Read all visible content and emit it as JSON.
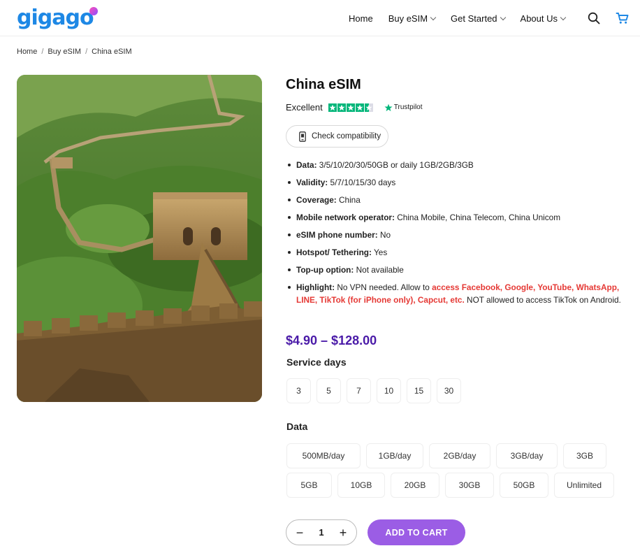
{
  "header": {
    "logo": "gigago",
    "nav": [
      "Home",
      "Buy eSIM",
      "Get Started",
      "About Us"
    ],
    "colors": {
      "brand": "#1e88e5",
      "logo_dot": "#c04dff"
    }
  },
  "breadcrumb": [
    "Home",
    "Buy eSIM",
    "China eSIM"
  ],
  "product": {
    "title": "China eSIM",
    "rating_text": "Excellent",
    "rating_stars": 4.5,
    "trustpilot": "Trustpilot",
    "check_compat": "Check compatibility",
    "features": [
      {
        "label": "Data:",
        "value": "3/5/10/20/30/50GB or daily 1GB/2GB/3GB"
      },
      {
        "label": "Validity:",
        "value": "5/7/10/15/30 days"
      },
      {
        "label": "Coverage:",
        "value": "China"
      },
      {
        "label": "Mobile network operator:",
        "value": "China Mobile, China Telecom, China Unicom"
      },
      {
        "label": "eSIM phone number:",
        "value": "No"
      },
      {
        "label": "Hotspot/ Tethering:",
        "value": "Yes"
      },
      {
        "label": "Top-up option:",
        "value": "Not available"
      }
    ],
    "highlight": {
      "label": "Highlight:",
      "pre": "No VPN needed. Allow to ",
      "red": "access Facebook, Google, YouTube, WhatsApp, LINE, TikTok (for iPhone only), Capcut, etc.",
      "post": " NOT allowed to access TikTok on Android."
    },
    "price": "$4.90 – $128.00",
    "service_days_label": "Service days",
    "service_days": [
      "3",
      "5",
      "7",
      "10",
      "15",
      "30"
    ],
    "data_label": "Data",
    "data_row1": [
      "500MB/day",
      "1GB/day",
      "2GB/day",
      "3GB/day",
      "3GB"
    ],
    "data_row2": [
      "5GB",
      "10GB",
      "20GB",
      "30GB",
      "50GB",
      "Unlimited"
    ],
    "quantity": "1",
    "qty_minus": "−",
    "qty_plus": "+",
    "add_to_cart": "ADD TO CART",
    "colors": {
      "price": "#4a1aa8",
      "add_to_cart": "#9b5de5",
      "highlight": "#e53935",
      "trustpilot": "#00b67a"
    }
  }
}
